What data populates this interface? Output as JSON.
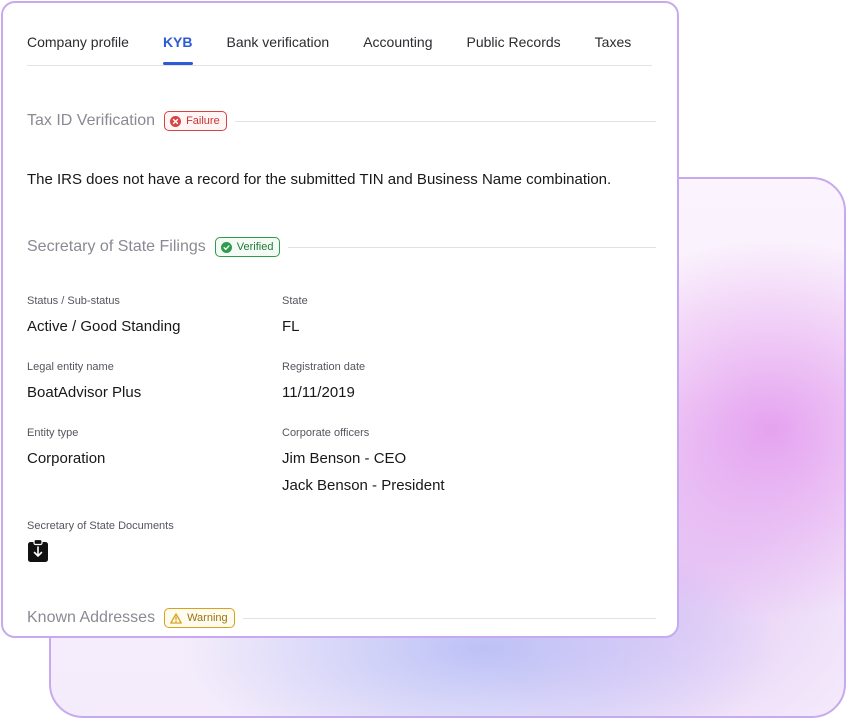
{
  "tabs": [
    {
      "label": "Company profile",
      "active": false
    },
    {
      "label": "KYB",
      "active": true
    },
    {
      "label": "Bank verification",
      "active": false
    },
    {
      "label": "Accounting",
      "active": false
    },
    {
      "label": "Public Records",
      "active": false
    },
    {
      "label": "Taxes",
      "active": false
    }
  ],
  "tax_id": {
    "title": "Tax ID Verification",
    "badge": "Failure",
    "message": "The IRS does not have a record for the submitted TIN and Business Name combination."
  },
  "sos": {
    "title": "Secretary of State Filings",
    "badge": "Verified",
    "fields": {
      "status_label": "Status / Sub-status",
      "status_value": "Active / Good Standing",
      "state_label": "State",
      "state_value": "FL",
      "legal_name_label": "Legal entity name",
      "legal_name_value": "BoatAdvisor Plus",
      "reg_date_label": "Registration date",
      "reg_date_value": "11/11/2019",
      "entity_type_label": "Entity type",
      "entity_type_value": "Corporation",
      "officers_label": "Corporate officers",
      "officers": [
        "Jim Benson - CEO",
        "Jack Benson - President"
      ],
      "documents_label": "Secretary of State Documents"
    }
  },
  "addresses": {
    "title": "Known Addresses",
    "badge": "Warning"
  },
  "colors": {
    "accent": "#2b5bd6",
    "failure": "#d64545",
    "verified": "#2f9b4c",
    "warning": "#d7a21c",
    "card_border": "#c7a9ef"
  },
  "icons": {
    "failure": "x-circle-icon",
    "verified": "check-circle-icon",
    "warning": "warning-triangle-icon",
    "document": "clipboard-download-icon"
  }
}
